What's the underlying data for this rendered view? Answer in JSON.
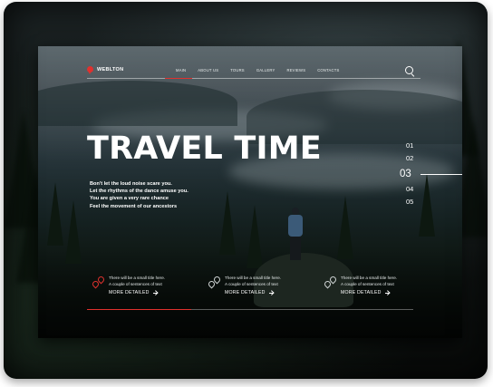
{
  "site": {
    "logo_text": "WEBLTON",
    "brand_color": "#e0312e",
    "nav": [
      {
        "label": "MAIN"
      },
      {
        "label": "ABOUT US"
      },
      {
        "label": "TOURS"
      },
      {
        "label": "GALLERY"
      },
      {
        "label": "REVIEWS"
      },
      {
        "label": "CONTACTS"
      }
    ],
    "search_icon": "search-icon"
  },
  "hero": {
    "title": "TRAVEL TIME",
    "lines": [
      "Bon't let the loud noise scare you.",
      "Let the rhythms of the dance amuse you.",
      "You are given a very rare chance",
      "Feel the movement of our ancestors"
    ]
  },
  "slides": {
    "numbers": [
      "01",
      "02",
      "03",
      "04",
      "05"
    ],
    "active_index": 2
  },
  "cards": [
    {
      "line1": "There will be a small title here.",
      "line2": "A couple of sentences of text",
      "link": "MORE DETAILED",
      "icon": "map-pin-icon",
      "active": true
    },
    {
      "line1": "There will be a small title here.",
      "line2": "A couple of sentences of text",
      "link": "MORE DETAILED",
      "icon": "map-pin-icon",
      "active": false
    },
    {
      "line1": "There will be a small title here.",
      "line2": "A couple of sentences of text",
      "link": "MORE DETAILED",
      "icon": "map-pin-icon",
      "active": false
    }
  ],
  "progress": {
    "fraction": 0.32
  }
}
